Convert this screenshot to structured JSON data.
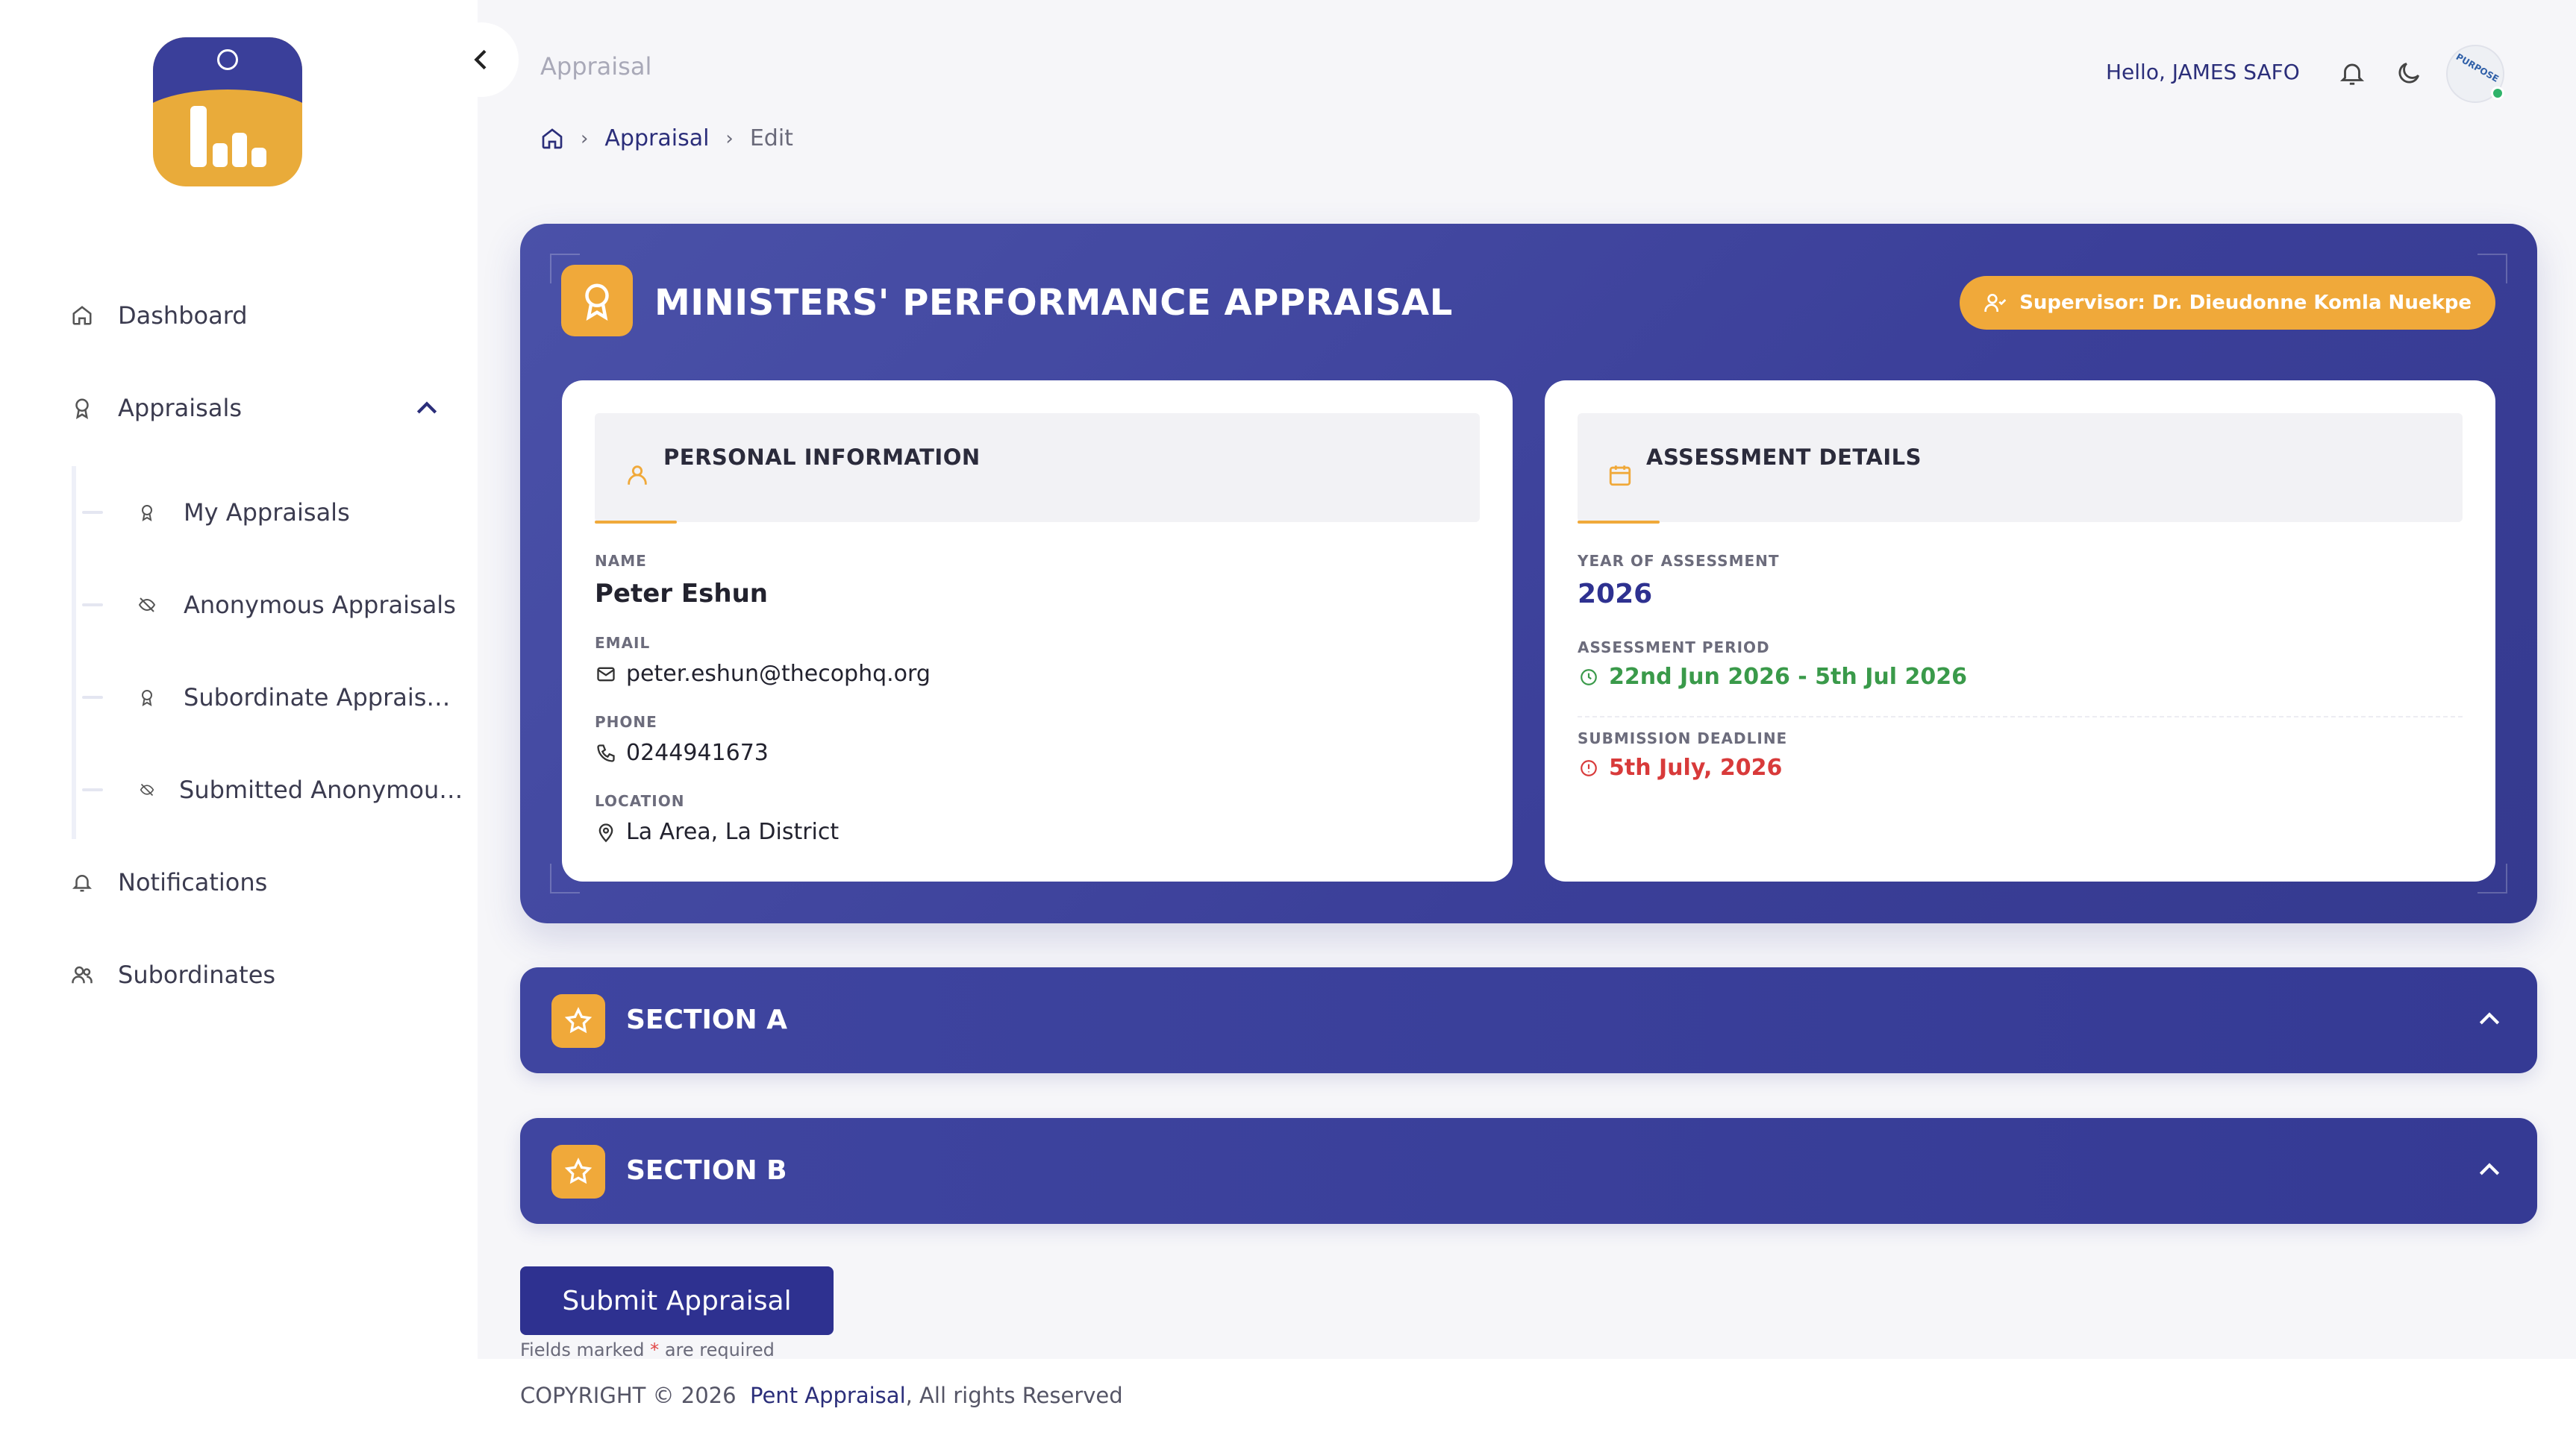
{
  "header": {
    "page_title": "Appraisal",
    "greeting": "Hello, JAMES SAFO",
    "avatar_text": "PURPOSE"
  },
  "breadcrumb": {
    "appraisal": "Appraisal",
    "current": "Edit"
  },
  "sidebar": {
    "items": [
      {
        "label": "Dashboard",
        "icon": "home-icon"
      },
      {
        "label": "Appraisals",
        "icon": "award-icon"
      },
      {
        "label": "Notifications",
        "icon": "bell-icon"
      },
      {
        "label": "Subordinates",
        "icon": "users-icon"
      }
    ],
    "sub_items": [
      {
        "label": "My Appraisals",
        "icon": "award-icon"
      },
      {
        "label": "Anonymous Appraisals",
        "icon": "eye-off-icon"
      },
      {
        "label": "Subordinate Apprais…",
        "icon": "award-icon"
      },
      {
        "label": "Submitted Anonymou…",
        "icon": "eye-off-icon"
      }
    ]
  },
  "hero": {
    "title": "MINISTERS' PERFORMANCE APPRAISAL",
    "supervisor": "Supervisor: Dr. Dieudonne Komla Nuekpe"
  },
  "personal": {
    "title": "PERSONAL INFORMATION",
    "name_label": "NAME",
    "name": "Peter Eshun",
    "email_label": "EMAIL",
    "email": "peter.eshun@thecophq.org",
    "phone_label": "PHONE",
    "phone": "0244941673",
    "location_label": "LOCATION",
    "location": "La Area, La District"
  },
  "assessment": {
    "title": "ASSESSMENT DETAILS",
    "year_label": "YEAR OF ASSESSMENT",
    "year": "2026",
    "period_label": "ASSESSMENT PERIOD",
    "period": "22nd Jun 2026 - 5th Jul 2026",
    "deadline_label": "SUBMISSION DEADLINE",
    "deadline": "5th July, 2026"
  },
  "sections": [
    {
      "label": "SECTION A"
    },
    {
      "label": "SECTION B"
    }
  ],
  "form": {
    "submit_label": "Submit Appraisal",
    "req_prefix": "Fields marked",
    "req_star": "*",
    "req_suffix": "are required"
  },
  "footer": {
    "prefix": "COPYRIGHT © 2026",
    "brand": "Pent Appraisal",
    "suffix": ", All rights Reserved"
  },
  "colors": {
    "primary": "#3b3f99",
    "accent": "#f0a93a",
    "success": "#3a9a4a",
    "danger": "#d83a3a"
  }
}
